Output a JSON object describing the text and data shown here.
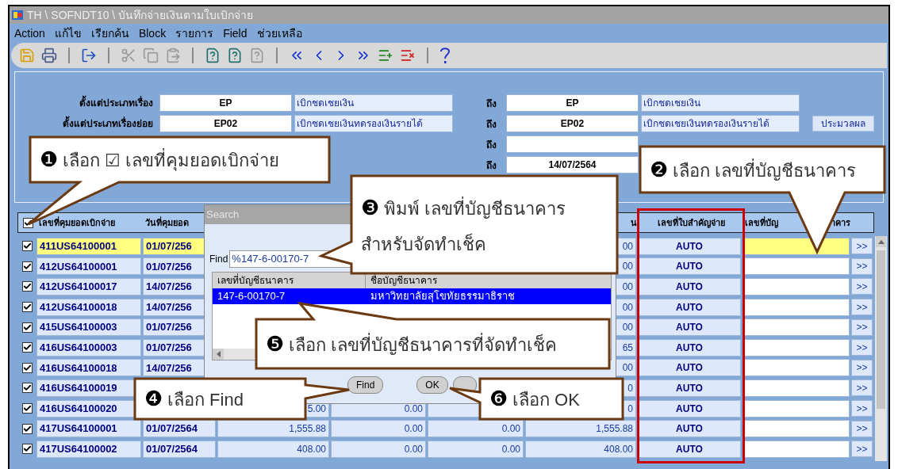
{
  "window": {
    "title": "TH \\ SOFNDT10 \\ บันทึกจ่ายเงินตามใบเบิกจ่าย"
  },
  "menu": [
    "Action",
    "แก้ไข",
    "เรียกค้น",
    "Block",
    "รายการ",
    "Field",
    "ช่วยเหลือ"
  ],
  "form": {
    "rows": [
      {
        "label": "ตั้งแต่ประเภทเรื่อง",
        "from_code": {
          "value": "EP"
        },
        "from_desc": {
          "value": "เบิกชดเชยเงิน"
        },
        "to_label": "ถึง",
        "to_code": {
          "value": "EP"
        },
        "to_desc": {
          "value": "เบิกชดเชยเงิน"
        }
      },
      {
        "label": "ตั้งแต่ประเภทเรื่องย่อย",
        "from_code": {
          "value": "EP02"
        },
        "from_desc": {
          "value": "เบิกชดเชยเงินทดรองเงินรายได้"
        },
        "to_label": "ถึง",
        "to_code": {
          "value": "EP02"
        },
        "to_desc": {
          "value": "เบิกชดเชยเงินทดรองเงินรายได้"
        }
      },
      {
        "to_label": "ถึง",
        "to_code": {}
      },
      {
        "to_label": "ถึง",
        "to_code": {
          "value": "14/07/2564"
        }
      }
    ],
    "process_button": "ประมวลผล"
  },
  "table": {
    "select_all": {
      "checked": true
    },
    "columns": [
      {
        "label": "เลขที่คุมยอดเบิกจ่าย"
      },
      {
        "label": "วันที่คุมยอด"
      },
      {},
      {},
      {},
      {
        "label": "น"
      },
      {
        "label": "เลขที่ใบสำคัญจ่าย",
        "marker": {
          "kind": "outline"
        }
      },
      {
        "parts": [
          "เลขที่บัญ",
          "าคาร"
        ]
      }
    ],
    "rows": [
      {
        "checked": true,
        "selected": true,
        "cells": {
          "column_1": "411US64100001",
          "column_2": "01/07/256",
          "column_6": "00",
          "column_7": "AUTO"
        },
        "more": ">>"
      },
      {
        "checked": true,
        "selected": false,
        "cells": {
          "column_1": "412US64100001",
          "column_2": "01/07/256",
          "column_6": "00",
          "column_7": "AUTO"
        },
        "more": ">>"
      },
      {
        "checked": true,
        "selected": false,
        "cells": {
          "column_1": "412US64100017",
          "column_2": "14/07/256",
          "column_6": "00",
          "column_7": "AUTO"
        },
        "more": ">>"
      },
      {
        "checked": true,
        "selected": false,
        "cells": {
          "column_1": "412US64100018",
          "column_2": "14/07/256",
          "column_6": "00",
          "column_7": "AUTO"
        },
        "more": ">>"
      },
      {
        "checked": true,
        "selected": false,
        "cells": {
          "column_1": "415US64100003",
          "column_2": "01/07/256",
          "column_6": "00",
          "column_7": "AUTO"
        },
        "more": ">>"
      },
      {
        "checked": true,
        "selected": false,
        "cells": {
          "column_1": "416US64100003",
          "column_2": "01/07/256",
          "column_6": "65",
          "column_7": "AUTO"
        },
        "more": ">>"
      },
      {
        "checked": true,
        "selected": false,
        "cells": {
          "column_1": "416US64100018",
          "column_2": "14/07/256",
          "column_6": "00",
          "column_7": "AUTO"
        },
        "more": ">>"
      },
      {
        "checked": true,
        "selected": false,
        "cells": {
          "column_1": "416US64100019",
          "column_6": "0",
          "column_7": "AUTO"
        },
        "more": ">>"
      },
      {
        "checked": true,
        "selected": false,
        "cells": {
          "column_1": "416US64100020",
          "column_3": "5.00",
          "column_4": "0.00",
          "column_6": "0",
          "column_7": "AUTO"
        },
        "more": ">>"
      },
      {
        "checked": true,
        "selected": false,
        "cells": {
          "column_1": "417US64100001",
          "column_2": "01/07/2564",
          "column_3": "1,555.88",
          "column_4": "0.00",
          "column_5": "0.00",
          "column_6": "1,555.88",
          "column_7": "AUTO"
        },
        "more": ">>"
      },
      {
        "checked": true,
        "selected": false,
        "cells": {
          "column_1": "417US64100002",
          "column_2": "01/07/2564",
          "column_3": "408.00",
          "column_4": "0.00",
          "column_5": "0.00",
          "column_6": "408.00",
          "column_7": "AUTO"
        },
        "more": ">>"
      }
    ]
  },
  "search_dialog": {
    "title": "Search",
    "find_label": "Find",
    "find_value": "%147-6-00170-7",
    "list": {
      "columns": [
        "เลขที่บัญชีธนาคาร",
        "ชื่อบัญชีธนาคาร"
      ],
      "rows": [
        {
          "selected": true,
          "cells": [
            "147-6-00170-7",
            "มหาวิทยาลัยสุโขทัยธรรมาธิราช"
          ]
        }
      ]
    },
    "buttons": [
      "Find",
      "OK"
    ],
    "partial_button": true
  },
  "callouts": [
    {
      "number": "❶",
      "lines": [
        "เลือก ☑ เลขที่คุมยอดเบิกจ่าย"
      ]
    },
    {
      "number": "❷",
      "lines": [
        "เลือก  เลขที่บัญชีธนาคาร"
      ]
    },
    {
      "number": "❸",
      "lines": [
        "พิมพ์ เลขที่บัญชีธนาคาร",
        "สำหรับจัดทำเช็ค"
      ]
    },
    {
      "number": "❹",
      "lines": [
        "เลือก  Find"
      ]
    },
    {
      "number": "❺",
      "lines": [
        "เลือก  เลขที่บัญชีธนาคารที่จัดทำเช็ค"
      ]
    },
    {
      "number": "❻",
      "lines": [
        "เลือก  OK"
      ]
    }
  ]
}
